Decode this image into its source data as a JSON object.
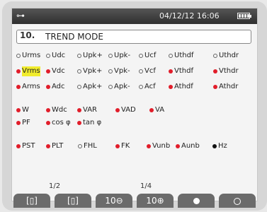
{
  "status_bar": {
    "datetime": "04/12/12 16:06",
    "battery_bars": 4
  },
  "header": {
    "icon": "trend-icon",
    "icon_text": "10.",
    "title": "TREND MODE"
  },
  "rows": [
    [
      {
        "label": "Urms",
        "on": false
      },
      {
        "label": "Udc",
        "on": false
      },
      {
        "label": "Upk+",
        "on": false
      },
      {
        "label": "Upk-",
        "on": false
      },
      {
        "label": "Ucf",
        "on": false
      },
      {
        "label": "Uthdf",
        "on": false
      },
      {
        "label": "Uthdr",
        "on": false
      }
    ],
    [
      {
        "label": "Vrms",
        "on": true,
        "highlight": true
      },
      {
        "label": "Vdc",
        "on": true
      },
      {
        "label": "Vpk+",
        "on": false
      },
      {
        "label": "Vpk-",
        "on": false
      },
      {
        "label": "Vcf",
        "on": false
      },
      {
        "label": "Vthdf",
        "on": true
      },
      {
        "label": "Vthdr",
        "on": true
      }
    ],
    [
      {
        "label": "Arms",
        "on": true
      },
      {
        "label": "Adc",
        "on": true
      },
      {
        "label": "Apk+",
        "on": false
      },
      {
        "label": "Apk-",
        "on": false
      },
      {
        "label": "Acf",
        "on": false
      },
      {
        "label": "Athdf",
        "on": true
      },
      {
        "label": "Athdr",
        "on": true
      }
    ],
    [
      {
        "label": "W",
        "on": true
      },
      {
        "label": "Wdc",
        "on": true
      },
      {
        "label": "VAR",
        "on": true
      },
      {
        "label": "VAD",
        "on": true
      },
      {
        "label": "VA",
        "on": true
      }
    ],
    [
      {
        "label": "PF",
        "on": true
      },
      {
        "label": "cos φ",
        "on": true
      },
      {
        "label": "tan φ",
        "on": true
      }
    ],
    [
      {
        "label": "PST",
        "on": true
      },
      {
        "label": "PLT",
        "on": true
      },
      {
        "label": "FHL",
        "on": false
      },
      {
        "label": "FK",
        "on": true
      },
      {
        "label": "Vunb",
        "on": true
      },
      {
        "label": "Aunb",
        "on": true
      },
      {
        "label": "Hz",
        "on": true,
        "color": "black"
      }
    ]
  ],
  "pages": {
    "left": "1/2",
    "right": "1/4"
  },
  "tabs": [
    {
      "name": "config-1-tab",
      "label": "[▯]"
    },
    {
      "name": "config-2-tab",
      "label": "[▯]"
    },
    {
      "name": "zoom-out-tab",
      "label": "10⊖"
    },
    {
      "name": "zoom-in-tab",
      "label": "10⊕"
    },
    {
      "name": "record-tab",
      "label": "●"
    },
    {
      "name": "stop-tab",
      "label": "○"
    }
  ],
  "colors": {
    "on": "#e11d2a",
    "highlight": "#f1ec2c",
    "tab": "#6b6b6b"
  }
}
